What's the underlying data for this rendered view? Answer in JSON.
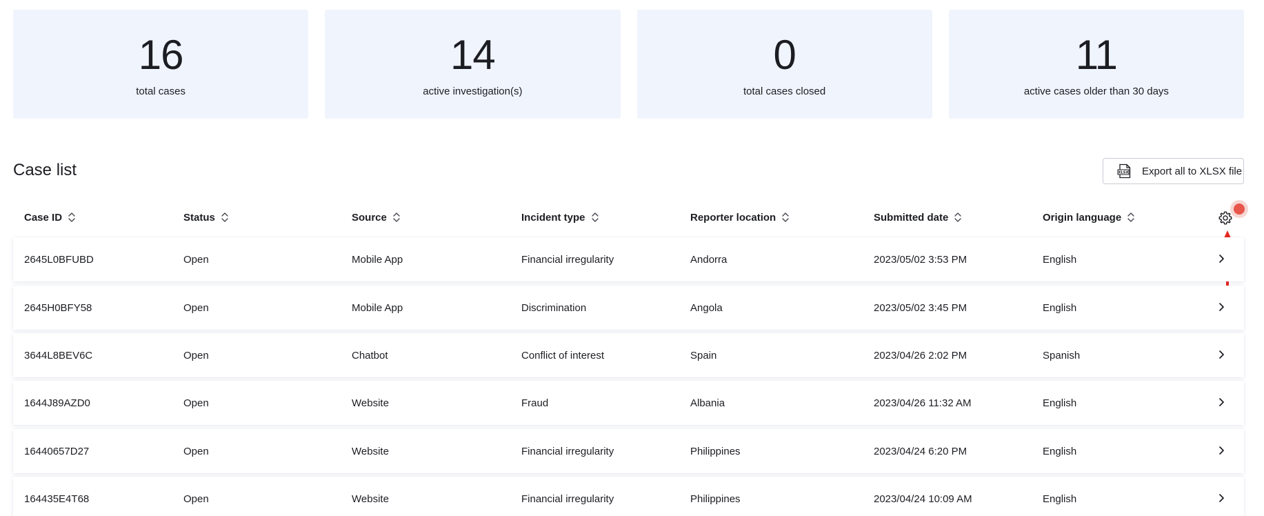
{
  "stats": [
    {
      "value": "16",
      "label": "total cases"
    },
    {
      "value": "14",
      "label": "active investigation(s)"
    },
    {
      "value": "0",
      "label": "total cases closed"
    },
    {
      "value": "11",
      "label": "active cases older than 30 days"
    }
  ],
  "case_list": {
    "title": "Case list",
    "export_label": "Export all to XLSX file",
    "columns": [
      "Case ID",
      "Status",
      "Source",
      "Incident type",
      "Reporter location",
      "Submitted date",
      "Origin language"
    ],
    "rows": [
      [
        "2645L0BFUBD",
        "Open",
        "Mobile App",
        "Financial irregularity",
        "Andorra",
        "2023/05/02 3:53 PM",
        "English"
      ],
      [
        "2645H0BFY58",
        "Open",
        "Mobile App",
        "Discrimination",
        "Angola",
        "2023/05/02 3:45 PM",
        "English"
      ],
      [
        "3644L8BEV6C",
        "Open",
        "Chatbot",
        "Conflict of interest",
        "Spain",
        "2023/04/26 2:02 PM",
        "Spanish"
      ],
      [
        "1644J89AZD0",
        "Open",
        "Website",
        "Fraud",
        "Albania",
        "2023/04/26 11:32 AM",
        "English"
      ],
      [
        "16440657D27",
        "Open",
        "Website",
        "Financial irregularity",
        "Philippines",
        "2023/04/24 6:20 PM",
        "English"
      ],
      [
        "164435E4T68",
        "Open",
        "Website",
        "Financial irregularity",
        "Philippines",
        "2023/04/24 10:09 AM",
        "English"
      ]
    ]
  },
  "icons": {
    "export": "xlsx-file-icon",
    "sort": "sort-icon",
    "settings": "gear-icon",
    "row_open": "chevron-right-icon",
    "annotation": "arrow-up-icon"
  },
  "colors": {
    "stat_bg": "#f0f4fd",
    "text": "#1c1d22",
    "annotation_red": "#e8271f",
    "dot": "#e8564c"
  }
}
